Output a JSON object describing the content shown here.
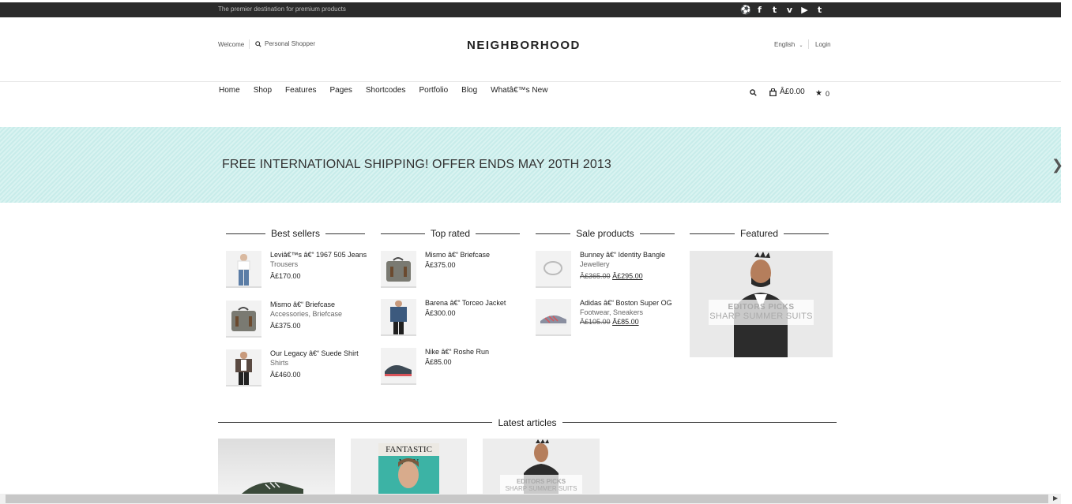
{
  "topbar": {
    "tagline": "The premier destination for premium products",
    "socials": [
      "dribbble-icon",
      "facebook-icon",
      "twitter-icon",
      "vimeo-icon",
      "youtube-icon",
      "tumblr-icon"
    ],
    "social_glyphs": [
      "⚽",
      "f",
      "t",
      "v",
      "▶",
      "t"
    ]
  },
  "header": {
    "welcome": "Welcome",
    "personal_shopper": "Personal Shopper",
    "logo": "NEIGHBORHOOD",
    "language": "English",
    "login": "Login"
  },
  "nav": {
    "items": [
      "Home",
      "Shop",
      "Features",
      "Pages",
      "Shortcodes",
      "Portfolio",
      "Blog",
      "Whatâ€™s New"
    ],
    "cart_total": "Â£0.00",
    "wishlist_count": "0"
  },
  "banner": {
    "message": "FREE INTERNATIONAL SHIPPING! OFFER ENDS MAY 20TH 2013"
  },
  "columns": [
    {
      "title": "Best sellers",
      "products": [
        {
          "name": "Leviâ€™s â€“ 1967 505 Jeans",
          "category": "Trousers",
          "price": "Â£170.00"
        },
        {
          "name": "Mismo â€“ Briefcase",
          "category": "Accessories, Briefcase",
          "price": "Â£375.00"
        },
        {
          "name": "Our Legacy â€“ Suede Shirt",
          "category": "Shirts",
          "price": "Â£460.00"
        }
      ]
    },
    {
      "title": "Top rated",
      "products": [
        {
          "name": "Mismo â€“ Briefcase",
          "price": "Â£375.00"
        },
        {
          "name": "Barena â€“ Torceo Jacket",
          "price": "Â£300.00"
        },
        {
          "name": "Nike â€“ Roshe Run",
          "price": "Â£85.00"
        }
      ]
    },
    {
      "title": "Sale products",
      "products": [
        {
          "name": "Bunney â€“ Identity Bangle",
          "category": "Jewellery",
          "old_price": "Â£365.00",
          "price": "Â£295.00"
        },
        {
          "name": "Adidas â€“ Boston Super OG",
          "category": "Footwear, Sneakers",
          "old_price": "Â£105.00",
          "price": "Â£85.00"
        }
      ]
    },
    {
      "title": "Featured",
      "editors_picks": "EDITORS PICKS",
      "subtitle": "SHARP SUMMER SUITS"
    }
  ],
  "latest": {
    "title": "Latest articles",
    "magazine_title": "FANTASTIC MAN",
    "card3_label": "EDITORS PICKS",
    "card3_sub": "SHARP SUMMER SUITS"
  }
}
